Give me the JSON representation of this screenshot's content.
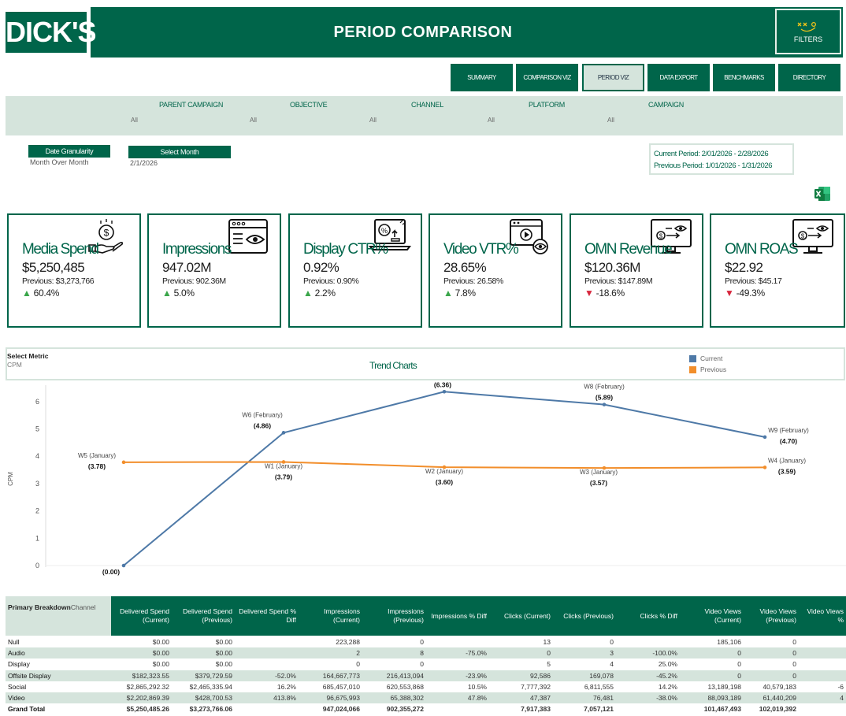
{
  "header": {
    "logo": "DICK'S",
    "title": "PERIOD COMPARISON",
    "filters_label": "FILTERS"
  },
  "nav": [
    {
      "label": "SUMMARY",
      "active": false
    },
    {
      "label": "COMPARISON VIZ",
      "active": false
    },
    {
      "label": "PERIOD VIZ",
      "active": true
    },
    {
      "label": "DATA EXPORT",
      "active": false
    },
    {
      "label": "BENCHMARKS",
      "active": false
    },
    {
      "label": "DIRECTORY",
      "active": false
    }
  ],
  "filters": [
    {
      "label": "PARENT CAMPAIGN",
      "value": "All"
    },
    {
      "label": "OBJECTIVE",
      "value": "All"
    },
    {
      "label": "CHANNEL",
      "value": "All"
    },
    {
      "label": "PLATFORM",
      "value": "All"
    },
    {
      "label": "CAMPAIGN",
      "value": "All"
    }
  ],
  "controls": {
    "granularity_label": "Date Granularity",
    "granularity_value": "Month Over Month",
    "month_label": "Select Month",
    "month_value": "2/1/2026"
  },
  "period": {
    "current": "Current Period:  2/01/2026 - 2/28/2026",
    "previous": "Previous Period:  1/01/2026 - 1/31/2026"
  },
  "kpis": [
    {
      "title": "Media Spend",
      "value": "$5,250,485",
      "previous": "Previous: $3,273,766",
      "change": "60.4%",
      "dir": "up",
      "icon": "money-hand-icon"
    },
    {
      "title": "Impressions",
      "value": "947.02M",
      "previous": "Previous: 902.36M",
      "change": "5.0%",
      "dir": "up",
      "icon": "browser-eye-icon"
    },
    {
      "title": "Display CTR%",
      "value": "0.92%",
      "previous": "Previous: 0.90%",
      "change": "2.2%",
      "dir": "up",
      "icon": "laptop-percent-icon"
    },
    {
      "title": "Video VTR%",
      "value": "28.65%",
      "previous": "Previous: 26.58%",
      "change": "7.8%",
      "dir": "up",
      "icon": "video-eye-icon"
    },
    {
      "title": "OMN Revenue",
      "value": "$120.36M",
      "previous": "Previous: $147.89M",
      "change": "-18.6%",
      "dir": "down",
      "icon": "monitor-money-icon"
    },
    {
      "title": "OMN ROAS",
      "value": "$22.92",
      "previous": "Previous: $45.17",
      "change": "-49.3%",
      "dir": "down",
      "icon": "monitor-money-icon"
    }
  ],
  "trend": {
    "select_metric_label": "Select Metric",
    "select_metric_value": "CPM",
    "title": "Trend Charts",
    "legend": [
      {
        "name": "Current",
        "color": "#4e79a7"
      },
      {
        "name": "Previous",
        "color": "#f28e2b"
      }
    ]
  },
  "chart_data": {
    "type": "line",
    "ylabel": "CPM",
    "ylim": [
      0,
      6.5
    ],
    "yticks": [
      0,
      1,
      2,
      3,
      4,
      5,
      6
    ],
    "grid": false,
    "series": [
      {
        "name": "Current",
        "color": "#4e79a7",
        "points": [
          {
            "label": "",
            "value": 0.0,
            "text": "(0.00)"
          },
          {
            "label": "W6 (February)",
            "value": 4.86,
            "text": "(4.86)"
          },
          {
            "label": "W7 (February)",
            "value": 6.36,
            "text": "(6.36)"
          },
          {
            "label": "W8 (February)",
            "value": 5.89,
            "text": "(5.89)"
          },
          {
            "label": "W9 (February)",
            "value": 4.7,
            "text": "(4.70)"
          }
        ]
      },
      {
        "name": "Previous",
        "color": "#f28e2b",
        "points": [
          {
            "label": "W5 (January)",
            "value": 3.78,
            "text": "(3.78)"
          },
          {
            "label": "W1 (January)",
            "value": 3.79,
            "text": "(3.79)"
          },
          {
            "label": "W2 (January)",
            "value": 3.6,
            "text": "(3.60)"
          },
          {
            "label": "W3 (January)",
            "value": 3.57,
            "text": "(3.57)"
          },
          {
            "label": "W4 (January)",
            "value": 3.59,
            "text": "(3.59)"
          }
        ]
      }
    ]
  },
  "table": {
    "first_header": "Primary Breakdown",
    "first_sub": "Channel",
    "columns": [
      "Delivered Spend (Current)",
      "Delivered Spend (Previous)",
      "Delivered Spend % Diff",
      "Impressions (Current)",
      "Impressions (Previous)",
      "Impressions % Diff",
      "Clicks (Current)",
      "Clicks (Previous)",
      "Clicks % Diff",
      "Video Views (Current)",
      "Video Views (Previous)",
      "Video Views %"
    ],
    "rows": [
      {
        "name": "Null",
        "cells": [
          "$0.00",
          "$0.00",
          "",
          "223,288",
          "0",
          "",
          "13",
          "0",
          "",
          "185,106",
          "0",
          ""
        ]
      },
      {
        "name": "Audio",
        "cells": [
          "$0.00",
          "$0.00",
          "",
          "2",
          "8",
          "-75.0%",
          "0",
          "3",
          "-100.0%",
          "0",
          "0",
          ""
        ]
      },
      {
        "name": "Display",
        "cells": [
          "$0.00",
          "$0.00",
          "",
          "0",
          "0",
          "",
          "5",
          "4",
          "25.0%",
          "0",
          "0",
          ""
        ]
      },
      {
        "name": "Offsite Display",
        "cells": [
          "$182,323.55",
          "$379,729.59",
          "-52.0%",
          "164,667,773",
          "216,413,094",
          "-23.9%",
          "92,586",
          "169,078",
          "-45.2%",
          "0",
          "0",
          ""
        ]
      },
      {
        "name": "Social",
        "cells": [
          "$2,865,292.32",
          "$2,465,335.94",
          "16.2%",
          "685,457,010",
          "620,553,868",
          "10.5%",
          "7,777,392",
          "6,811,555",
          "14.2%",
          "13,189,198",
          "40,579,183",
          "-6"
        ]
      },
      {
        "name": "Video",
        "cells": [
          "$2,202,869.39",
          "$428,700.53",
          "413.8%",
          "96,675,993",
          "65,388,302",
          "47.8%",
          "47,387",
          "76,481",
          "-38.0%",
          "88,093,189",
          "61,440,209",
          "4"
        ]
      },
      {
        "name": "Grand Total",
        "cells": [
          "$5,250,485.26",
          "$3,273,766.06",
          "",
          "947,024,066",
          "902,355,272",
          "",
          "7,917,383",
          "7,057,121",
          "",
          "101,467,493",
          "102,019,392",
          ""
        ]
      }
    ]
  }
}
